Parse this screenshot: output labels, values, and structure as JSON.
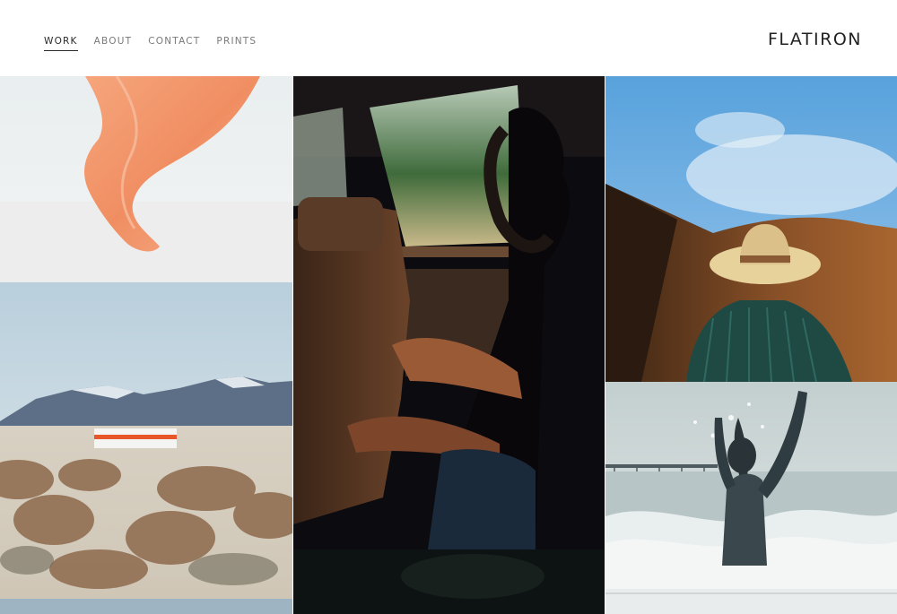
{
  "header": {
    "brand": "FLATIRON",
    "nav": [
      {
        "label": "WORK",
        "active": true
      },
      {
        "label": "ABOUT",
        "active": false
      },
      {
        "label": "CONTACT",
        "active": false
      },
      {
        "label": "PRINTS",
        "active": false
      }
    ]
  },
  "colors": {
    "background": "#ffffff",
    "nav_active": "#2b2b2b",
    "nav_inactive": "#7a7a7a",
    "brand": "#222222"
  }
}
